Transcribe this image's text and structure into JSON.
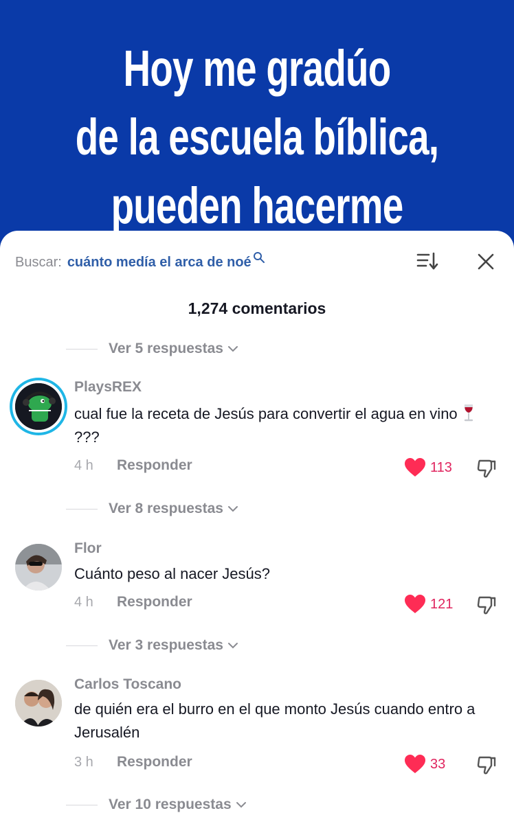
{
  "banner": {
    "lines": [
      "Hoy me gradúo",
      "de la escuela bíblica,",
      "pueden hacerme"
    ],
    "background": "#0a3aa8"
  },
  "search": {
    "label": "Buscar:",
    "query": "cuánto medía el arca de noé",
    "icon": "search-icon"
  },
  "header_icons": [
    "sort-icon",
    "close-icon"
  ],
  "comments_count": "1,274 comentarios",
  "comments": [
    {
      "replies_above": "Ver 5 respuestas",
      "username": "PlaysREX",
      "text_before_emoji": "cual fue la receta de Jesús para convertir el agua en vino ",
      "emoji": "wine-glass",
      "text_after_emoji": "???",
      "time": "4 h",
      "reply_label": "Responder",
      "likes": "113"
    },
    {
      "replies_above": "Ver 8 respuestas",
      "username": "Flor",
      "text": "Cuánto peso al nacer Jesús?",
      "time": "4 h",
      "reply_label": "Responder",
      "likes": "121"
    },
    {
      "replies_above": "Ver 3 respuestas",
      "username": "Carlos Toscano",
      "text": "de quién era el burro en el que monto Jesús cuando entro a Jerusalén",
      "time": "3 h",
      "reply_label": "Responder",
      "likes": "33"
    }
  ],
  "replies_bottom": "Ver 10 respuestas",
  "colors": {
    "accent_blue": "#2f5ea8",
    "like_red": "#e0245e",
    "ring": "#1fb6e6"
  }
}
